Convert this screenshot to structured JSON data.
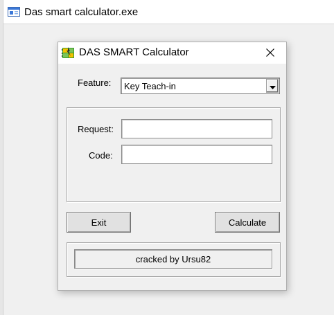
{
  "parent_window": {
    "title": "Das smart calculator.exe",
    "icon": "console-window-icon"
  },
  "dialog": {
    "title": "DAS SMART Calculator",
    "icon": "calculator-chip-icon",
    "close_icon": "close-icon",
    "feature": {
      "label": "Feature:",
      "selected": "Key Teach-in"
    },
    "request": {
      "label": "Request:",
      "value": ""
    },
    "code": {
      "label": "Code:",
      "value": ""
    },
    "buttons": {
      "exit": "Exit",
      "calculate": "Calculate"
    },
    "status": "cracked by Ursu82"
  },
  "colors": {
    "face": "#f0f0f0",
    "titlebar": "#ffffff",
    "icon_green": "#3a9a2a",
    "icon_yellow": "#f2c200",
    "icon_blue": "#1e6fcf"
  }
}
